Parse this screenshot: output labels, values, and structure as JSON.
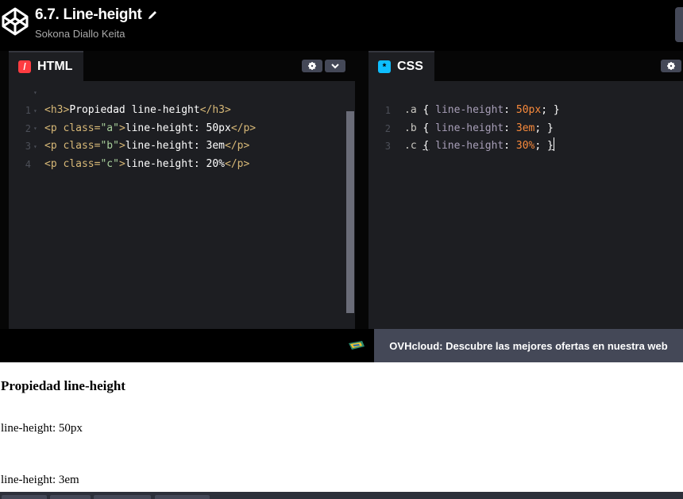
{
  "header": {
    "title": "6.7. Line-height",
    "author": "Sokona Diallo Keita",
    "icons": {
      "logo": "codepen-logo-icon",
      "edit": "pencil-icon"
    }
  },
  "html_editor": {
    "tab_label": "HTML",
    "tab_icon": "/",
    "tab_icon_color": "#ff3c41",
    "lines": [
      {
        "num": "1",
        "tag_open": "<h3>",
        "text": "Propiedad line-height",
        "tag_close": "</h3>"
      },
      {
        "num": "2",
        "tag_open": "<p ",
        "attr": "class=",
        "val": "\"a\"",
        "gt": ">",
        "text": "line-height: 50px",
        "tag_close": "</p>"
      },
      {
        "num": "3",
        "tag_open": "<p ",
        "attr": "class=",
        "val": "\"b\"",
        "gt": ">",
        "text": "line-height: 3em",
        "tag_close": "</p>"
      },
      {
        "num": "4",
        "tag_open": "<p ",
        "attr": "class=",
        "val": "\"c\"",
        "gt": ">",
        "text": "line-height: 20%",
        "tag_close": "</p>"
      }
    ]
  },
  "css_editor": {
    "tab_label": "CSS",
    "tab_icon": "*",
    "tab_icon_color": "#0ebeff",
    "lines": [
      {
        "num": "1",
        "sel": ".a",
        "prop": "line-height",
        "val": "50px"
      },
      {
        "num": "2",
        "sel": ".b",
        "prop": "line-height",
        "val": "3em"
      },
      {
        "num": "3",
        "sel": ".c",
        "prop": "line-height",
        "val": "30%"
      }
    ]
  },
  "ad": {
    "text": "OVHcloud: Descubre las mejores ofertas en nuestra web"
  },
  "preview": {
    "heading": "Propiedad line-height",
    "para_a": "line-height: 50px",
    "para_b": "line-height: 3em"
  }
}
